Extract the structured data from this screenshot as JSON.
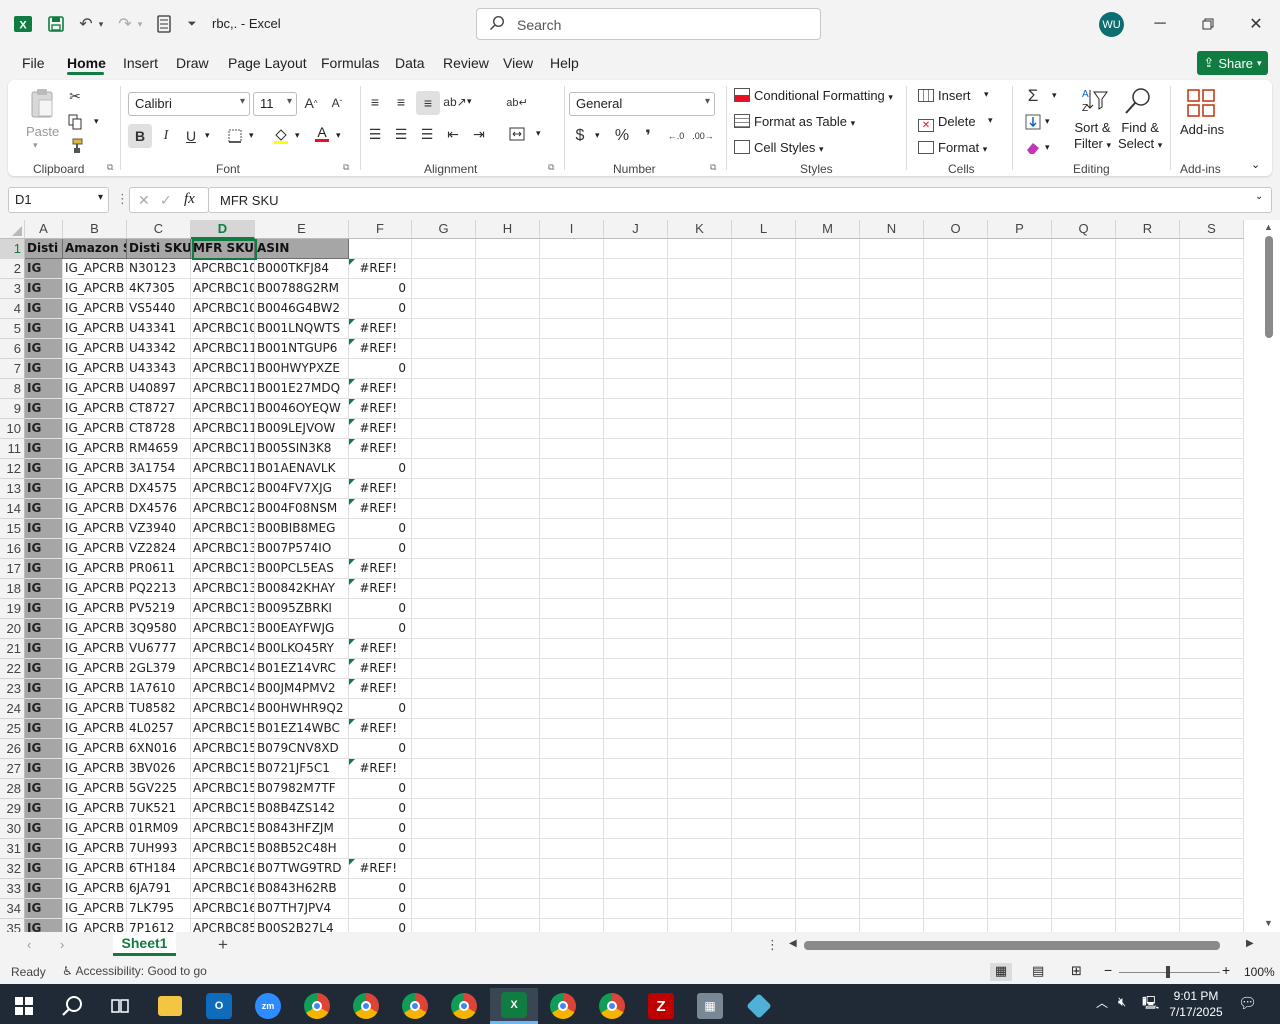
{
  "window": {
    "title": "rbc,. - Excel",
    "search_placeholder": "Search",
    "user_initials": "WU",
    "share_label": "Share"
  },
  "menu": [
    "File",
    "Home",
    "Insert",
    "Draw",
    "Page Layout",
    "Formulas",
    "Data",
    "Review",
    "View",
    "Help"
  ],
  "ribbon": {
    "clipboard": {
      "paste": "Paste",
      "label": "Clipboard"
    },
    "font": {
      "name": "Calibri",
      "size": "11",
      "label": "Font"
    },
    "alignment": {
      "label": "Alignment"
    },
    "number": {
      "format": "General",
      "label": "Number"
    },
    "styles": {
      "conditional": "Conditional Formatting",
      "as_table": "Format as Table",
      "cell_styles": "Cell Styles",
      "label": "Styles"
    },
    "cells": {
      "insert": "Insert",
      "delete": "Delete",
      "format": "Format",
      "label": "Cells"
    },
    "editing": {
      "sort1": "Sort &",
      "sort2": "Filter",
      "find1": "Find &",
      "find2": "Select",
      "label": "Editing"
    },
    "addins": {
      "button": "Add-ins",
      "label": "Add-ins"
    }
  },
  "formula_bar": {
    "name_box": "D1",
    "content": "MFR SKU"
  },
  "columns": [
    "A",
    "B",
    "C",
    "D",
    "E",
    "F",
    "G",
    "H",
    "I",
    "J",
    "K",
    "L",
    "M",
    "N",
    "O",
    "P",
    "Q",
    "R",
    "S"
  ],
  "header_row": [
    "Disti",
    "Amazon S",
    "Disti SKU",
    "MFR SKU",
    "ASIN"
  ],
  "rows": [
    {
      "n": "2",
      "a": "IG",
      "b": "IG_APCRB",
      "c": "N30123",
      "d": "APCRBC10",
      "e": "B000TKFJ84",
      "f": "#REF!"
    },
    {
      "n": "3",
      "a": "IG",
      "b": "IG_APCRB",
      "c": "4K7305",
      "d": "APCRBC10",
      "e": "B00788G2RM",
      "f": "0"
    },
    {
      "n": "4",
      "a": "IG",
      "b": "IG_APCRB",
      "c": "VS5440",
      "d": "APCRBC10",
      "e": "B0046G4BW2",
      "f": "0"
    },
    {
      "n": "5",
      "a": "IG",
      "b": "IG_APCRB",
      "c": "U43341",
      "d": "APCRBC10",
      "e": "B001LNQWTS",
      "f": "#REF!"
    },
    {
      "n": "6",
      "a": "IG",
      "b": "IG_APCRB",
      "c": "U43342",
      "d": "APCRBC11",
      "e": "B001NTGUP6",
      "f": "#REF!"
    },
    {
      "n": "7",
      "a": "IG",
      "b": "IG_APCRB",
      "c": "U43343",
      "d": "APCRBC11",
      "e": "B00HWYPXZE",
      "f": "0"
    },
    {
      "n": "8",
      "a": "IG",
      "b": "IG_APCRB",
      "c": "U40897",
      "d": "APCRBC11",
      "e": "B001E27MDQ",
      "f": "#REF!"
    },
    {
      "n": "9",
      "a": "IG",
      "b": "IG_APCRB",
      "c": "CT8727",
      "d": "APCRBC11",
      "e": "B0046OYEQW",
      "f": "#REF!"
    },
    {
      "n": "10",
      "a": "IG",
      "b": "IG_APCRB",
      "c": "CT8728",
      "d": "APCRBC11",
      "e": "B009LEJVOW",
      "f": "#REF!"
    },
    {
      "n": "11",
      "a": "IG",
      "b": "IG_APCRB",
      "c": "RM4659",
      "d": "APCRBC11",
      "e": "B005SIN3K8",
      "f": "#REF!"
    },
    {
      "n": "12",
      "a": "IG",
      "b": "IG_APCRB",
      "c": "3A1754",
      "d": "APCRBC11",
      "e": "B01AENAVLK",
      "f": "0"
    },
    {
      "n": "13",
      "a": "IG",
      "b": "IG_APCRB",
      "c": "DX4575",
      "d": "APCRBC12",
      "e": "B004FV7XJG",
      "f": "#REF!"
    },
    {
      "n": "14",
      "a": "IG",
      "b": "IG_APCRB",
      "c": "DX4576",
      "d": "APCRBC12",
      "e": "B004F08NSM",
      "f": "#REF!"
    },
    {
      "n": "15",
      "a": "IG",
      "b": "IG_APCRB",
      "c": "VZ3940",
      "d": "APCRBC13",
      "e": "B00BIB8MEG",
      "f": "0"
    },
    {
      "n": "16",
      "a": "IG",
      "b": "IG_APCRB",
      "c": "VZ2824",
      "d": "APCRBC13",
      "e": "B007P574IO",
      "f": "0"
    },
    {
      "n": "17",
      "a": "IG",
      "b": "IG_APCRB",
      "c": "PR0611",
      "d": "APCRBC13",
      "e": "B00PCL5EAS",
      "f": "#REF!"
    },
    {
      "n": "18",
      "a": "IG",
      "b": "IG_APCRB",
      "c": "PQ2213",
      "d": "APCRBC13",
      "e": "B00842KHAY",
      "f": "#REF!"
    },
    {
      "n": "19",
      "a": "IG",
      "b": "IG_APCRB",
      "c": "PV5219",
      "d": "APCRBC13",
      "e": "B0095ZBRKI",
      "f": "0"
    },
    {
      "n": "20",
      "a": "IG",
      "b": "IG_APCRB",
      "c": "3Q9580",
      "d": "APCRBC13",
      "e": "B00EAYFWJG",
      "f": "0"
    },
    {
      "n": "21",
      "a": "IG",
      "b": "IG_APCRB",
      "c": "VU6777",
      "d": "APCRBC14",
      "e": "B00LKO45RY",
      "f": "#REF!"
    },
    {
      "n": "22",
      "a": "IG",
      "b": "IG_APCRB",
      "c": "2GL379",
      "d": "APCRBC14",
      "e": "B01EZ14VRC",
      "f": "#REF!"
    },
    {
      "n": "23",
      "a": "IG",
      "b": "IG_APCRB",
      "c": "1A7610",
      "d": "APCRBC14",
      "e": "B00JM4PMV2",
      "f": "#REF!"
    },
    {
      "n": "24",
      "a": "IG",
      "b": "IG_APCRB",
      "c": "TU8582",
      "d": "APCRBC14",
      "e": "B00HWHR9Q2",
      "f": "0"
    },
    {
      "n": "25",
      "a": "IG",
      "b": "IG_APCRB",
      "c": "4L0257",
      "d": "APCRBC15",
      "e": "B01EZ14WBC",
      "f": "#REF!"
    },
    {
      "n": "26",
      "a": "IG",
      "b": "IG_APCRB",
      "c": "6XN016",
      "d": "APCRBC15",
      "e": "B079CNV8XD",
      "f": "0"
    },
    {
      "n": "27",
      "a": "IG",
      "b": "IG_APCRB",
      "c": "3BV026",
      "d": "APCRBC15",
      "e": "B0721JF5C1",
      "f": "#REF!"
    },
    {
      "n": "28",
      "a": "IG",
      "b": "IG_APCRB",
      "c": "5GV225",
      "d": "APCRBC15",
      "e": "B07982M7TF",
      "f": "0"
    },
    {
      "n": "29",
      "a": "IG",
      "b": "IG_APCRB",
      "c": "7UK521",
      "d": "APCRBC15",
      "e": "B08B4ZS142",
      "f": "0"
    },
    {
      "n": "30",
      "a": "IG",
      "b": "IG_APCRB",
      "c": "01RM09",
      "d": "APCRBC15",
      "e": "B0843HFZJM",
      "f": "0"
    },
    {
      "n": "31",
      "a": "IG",
      "b": "IG_APCRB",
      "c": "7UH993",
      "d": "APCRBC15",
      "e": "B08B52C48H",
      "f": "0"
    },
    {
      "n": "32",
      "a": "IG",
      "b": "IG_APCRB",
      "c": "6TH184",
      "d": "APCRBC16",
      "e": "B07TWG9TRD",
      "f": "#REF!"
    },
    {
      "n": "33",
      "a": "IG",
      "b": "IG_APCRB",
      "c": "6JA791",
      "d": "APCRBC16",
      "e": "B0843H62RB",
      "f": "0"
    },
    {
      "n": "34",
      "a": "IG",
      "b": "IG_APCRB",
      "c": "7LK795",
      "d": "APCRBC16",
      "e": "B07TH7JPV4",
      "f": "0"
    },
    {
      "n": "35",
      "a": "IG",
      "b": "IG_APCRB",
      "c": "7P1612",
      "d": "APCRBC85",
      "e": "B00S2B27L4",
      "f": "0"
    }
  ],
  "sheet_tab": "Sheet1",
  "status": {
    "ready": "Ready",
    "accessibility": "Accessibility: Good to go",
    "zoom": "100%"
  },
  "clock": {
    "time": "9:01 PM",
    "date": "7/17/2025"
  },
  "accent_color": "#107c41"
}
